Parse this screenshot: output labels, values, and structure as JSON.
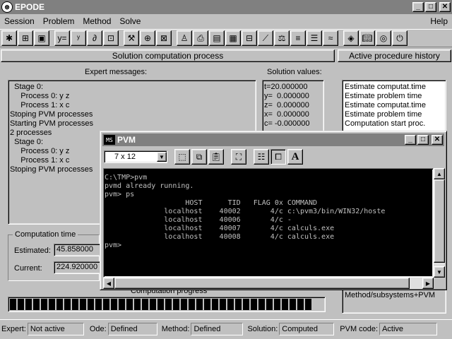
{
  "app": {
    "title": "EPODE",
    "icon": "epode-logo-icon"
  },
  "menu": {
    "items": [
      "Session",
      "Problem",
      "Method",
      "Solve"
    ],
    "help": "Help"
  },
  "toolbar": {
    "buttons": [
      "new-session-icon",
      "open-problem-icon",
      "save-icon",
      "function-y-icon",
      "equation-icon",
      "ode-icon",
      "graph-icon",
      "hammer-icon",
      "wizard-icon",
      "method-icon",
      "person-icon",
      "printer-icon",
      "table-icon",
      "grid-icon",
      "structure-icon",
      "plot-icon",
      "pendulum-icon",
      "balance-icon",
      "equalizer-icon",
      "spring-icon",
      "diamond-icon",
      "book-icon",
      "target-icon",
      "exit-icon"
    ]
  },
  "solution": {
    "header": "Solution computation process",
    "expert_label": "Expert messages:",
    "values_label": "Solution values:",
    "expert_lines": [
      "  Stage 0:",
      "     Process 0: y z",
      "     Process 1: x c",
      "Stoping PVM processes",
      "Starting PVM processes",
      "2 processes",
      "  Stage 0:",
      "     Process 0: y z",
      "     Process 1: x c",
      "Stoping PVM processes"
    ],
    "values_lines": [
      "t=20.000000",
      "y=  0.000000",
      "z=  0.000000",
      "x=  0.000000",
      "c= -0.000000"
    ]
  },
  "history": {
    "header": "Active procedure history",
    "lines": [
      "Estimate computat.time",
      "Estimate problem time",
      "Estimate computat.time",
      "Estimate problem time",
      "Computation start proc."
    ],
    "bottom": "Method/subsystems+PVM"
  },
  "computation_time": {
    "legend": "Computation time",
    "estimated_label": "Estimated:",
    "estimated_value": "45.858000",
    "current_label": "Current:",
    "current_value": "224.920000"
  },
  "progress": {
    "label": "Computation progress",
    "segments": 39
  },
  "status": {
    "expert_label": "Expert:",
    "expert_value": "Not active",
    "ode_label": "Ode:",
    "ode_value": "Defined",
    "method_label": "Method:",
    "method_value": "Defined",
    "solution_label": "Solution:",
    "solution_value": "Computed",
    "pvm_label": "PVM code:",
    "pvm_value": "Active"
  },
  "pvm": {
    "title": "PVM",
    "icon_text": "MS",
    "font_size": "7 x 12",
    "console": "C:\\TMP>pvm\npvmd already running.\npvm> ps\n                   HOST      TID   FLAG 0x COMMAND\n              localhost    40002       4/c c:\\pvm3/bin/WIN32/hoste\n              localhost    40006       4/c -\n              localhost    40007       4/c calculs.exe\n              localhost    40008       4/c calculs.exe\npvm> "
  }
}
